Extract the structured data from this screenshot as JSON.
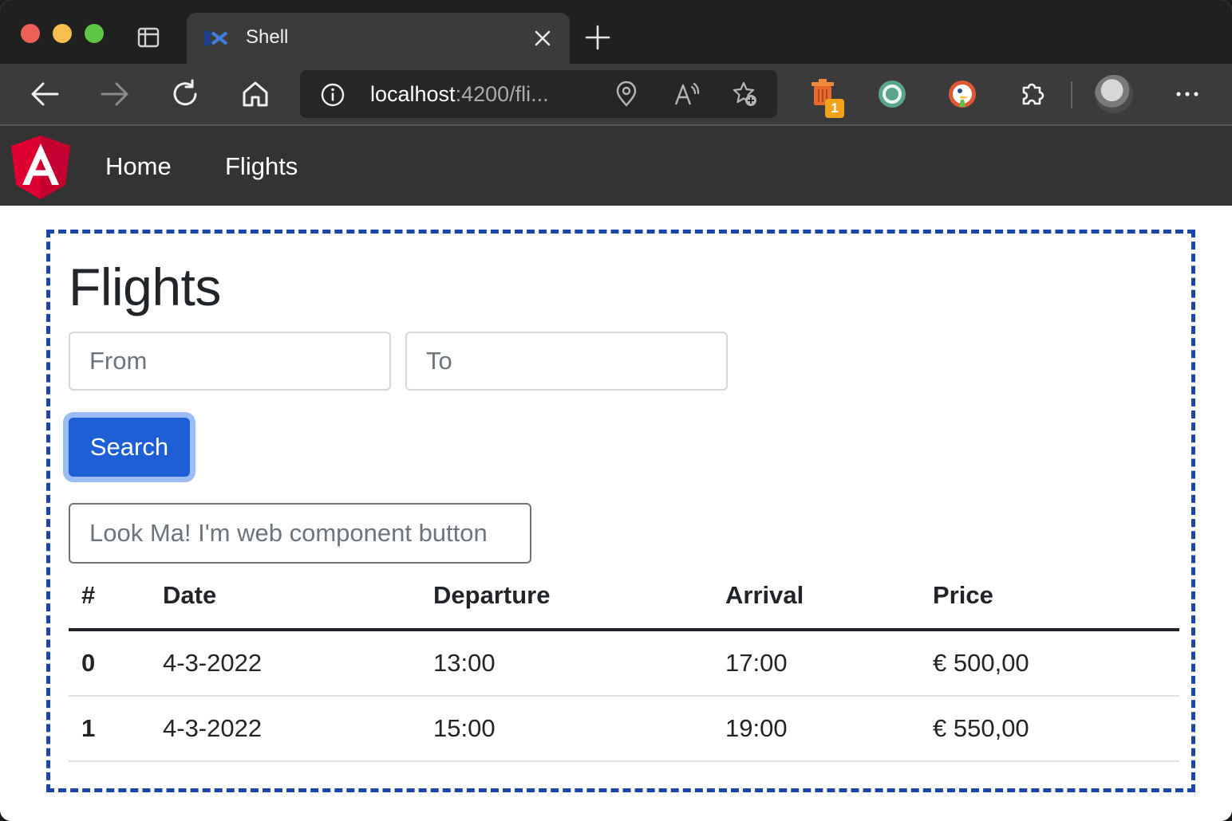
{
  "browser": {
    "tab": {
      "title": "Shell",
      "favicon": "module-federation-icon"
    },
    "address": {
      "host": "localhost",
      "rest": ":4200/fli..."
    },
    "extension_badge": "1",
    "icons": [
      "back-icon",
      "forward-icon",
      "reload-icon",
      "home-icon",
      "info-icon",
      "location-icon",
      "read-aloud-icon",
      "favorite-add-icon",
      "trash-extension-icon",
      "sync-extension-icon",
      "duckduckgo-icon",
      "extensions-icon",
      "profile-avatar",
      "more-icon"
    ]
  },
  "appnav": {
    "logo": "angular-logo",
    "links": [
      {
        "label": "Home"
      },
      {
        "label": "Flights"
      }
    ]
  },
  "main": {
    "title": "Flights",
    "from_placeholder": "From",
    "to_placeholder": "To",
    "search_label": "Search",
    "wc_button_label": "Look Ma! I'm web component button",
    "columns": [
      "#",
      "Date",
      "Departure",
      "Arrival",
      "Price"
    ],
    "rows": [
      {
        "id": "0",
        "date": "4-3-2022",
        "departure": "13:00",
        "arrival": "17:00",
        "price": "€ 500,00"
      },
      {
        "id": "1",
        "date": "4-3-2022",
        "departure": "15:00",
        "arrival": "19:00",
        "price": "€ 550,00"
      }
    ]
  },
  "colors": {
    "accent": "#1f5fd6",
    "focus_ring": "#9bbcf4",
    "mfe_border": "#1a47a6",
    "navbar": "#333333",
    "angular_red": "#dd0031"
  }
}
